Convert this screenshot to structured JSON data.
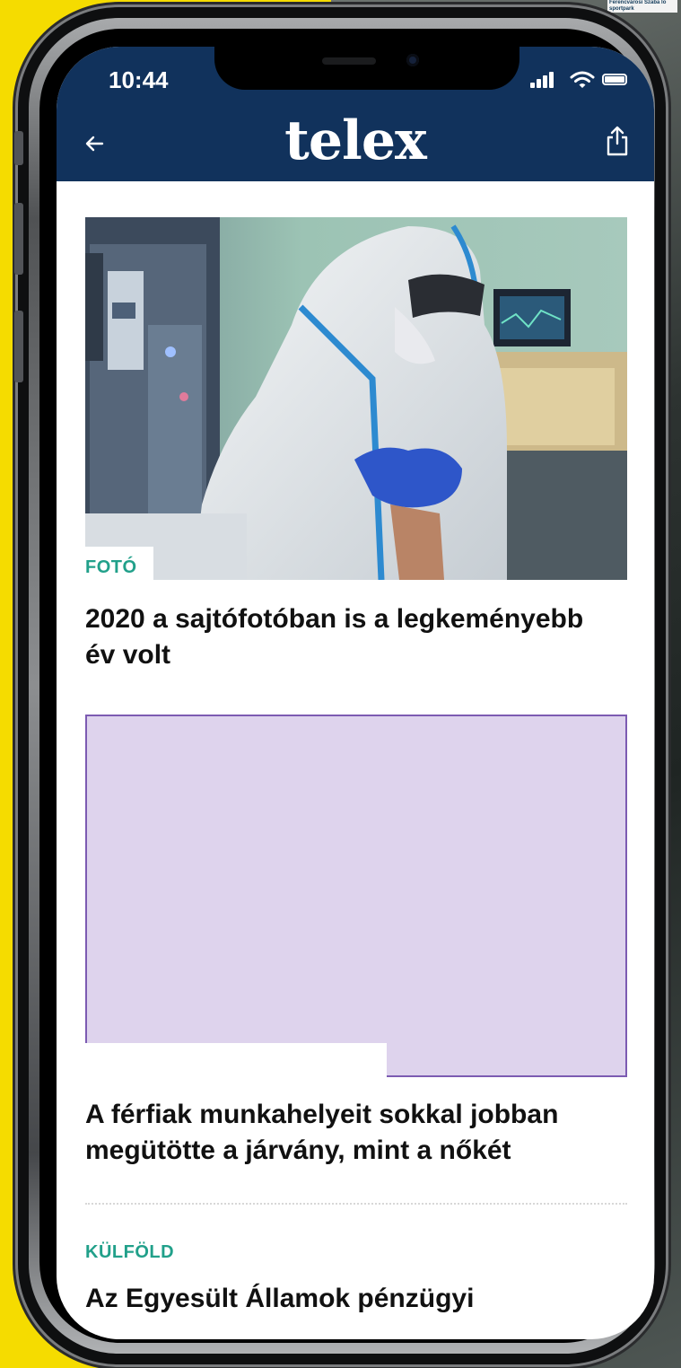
{
  "status_bar": {
    "time": "10:44"
  },
  "header": {
    "logo": "telex"
  },
  "articles": [
    {
      "tag": "FOTÓ",
      "title": "2020 a sajtófotóban is a legkeményebb év volt"
    },
    {
      "tag": "",
      "title": "A férfiak munkahelyeit sokkal jobban megütötte a járvány, mint a nőkét"
    },
    {
      "tag": "KÜLFÖLD",
      "title": "Az Egyesült Államok pénzügyi"
    }
  ],
  "background": {
    "corner_text": "Ferencvárosi Szaba lo sportpark"
  },
  "colors": {
    "header_bg": "#11325c",
    "tag_green": "#21a08a",
    "ad_bg": "#ded3ed",
    "ad_border": "#7c5bb2",
    "page_bg": "#f5dc00"
  },
  "icons": {
    "back": "back-arrow-icon",
    "share": "share-icon",
    "signal": "cellular-signal-icon",
    "wifi": "wifi-icon",
    "battery": "battery-icon"
  }
}
